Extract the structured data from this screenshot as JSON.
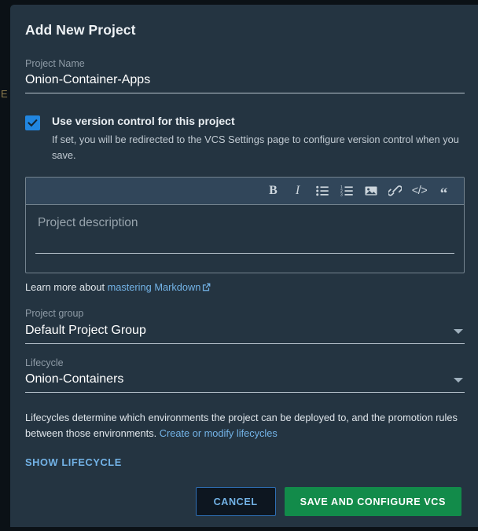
{
  "backdrop": {
    "clipped_glyph": "E"
  },
  "dialog": {
    "title": "Add New Project",
    "project_name": {
      "label": "Project Name",
      "value": "Onion-Container-Apps"
    },
    "version_control": {
      "checked": true,
      "title": "Use version control for this project",
      "description": "If set, you will be redirected to the VCS Settings page to configure version control when you save.",
      "checkbox_color": "#2186e0"
    },
    "description_editor": {
      "placeholder": "Project description",
      "toolbar": [
        {
          "name": "bold-icon",
          "glyph": "B"
        },
        {
          "name": "italic-icon",
          "glyph": "I"
        },
        {
          "name": "bulleted-list-icon",
          "glyph": ""
        },
        {
          "name": "numbered-list-icon",
          "glyph": ""
        },
        {
          "name": "image-icon",
          "glyph": ""
        },
        {
          "name": "link-icon",
          "glyph": ""
        },
        {
          "name": "code-icon",
          "glyph": "</>"
        },
        {
          "name": "quote-icon",
          "glyph": "“"
        }
      ]
    },
    "markdown_hint": {
      "text": "Learn more about ",
      "link_label": "mastering Markdown"
    },
    "project_group": {
      "label": "Project group",
      "value": "Default Project Group"
    },
    "lifecycle": {
      "label": "Lifecycle",
      "value": "Onion-Containers"
    },
    "lifecycle_note": {
      "text": "Lifecycles determine which environments the project can be deployed to, and the promotion rules between those environments. ",
      "link_label": "Create or modify lifecycles"
    },
    "show_lifecycle_label": "SHOW LIFECYCLE",
    "buttons": {
      "cancel": "CANCEL",
      "save": "SAVE AND CONFIGURE VCS",
      "save_color": "#128b4a",
      "cancel_color": "#73b3e7"
    }
  }
}
